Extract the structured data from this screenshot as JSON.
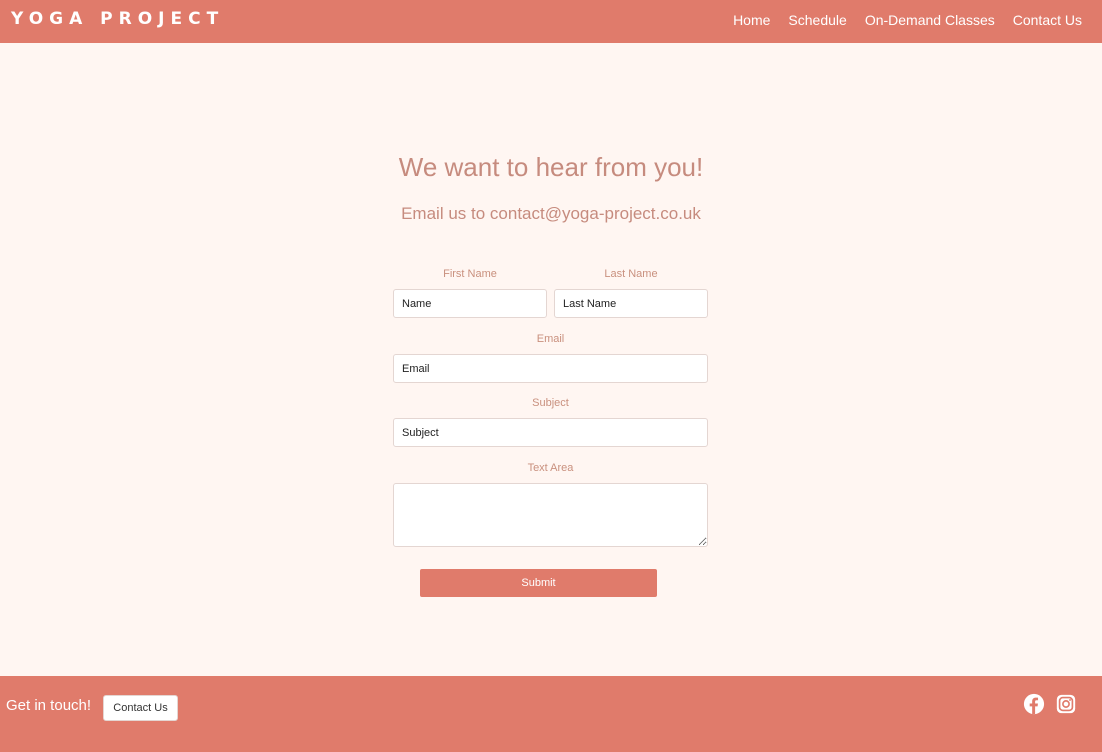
{
  "nav": {
    "brand": "YOGA PROJECT",
    "links": [
      "Home",
      "Schedule",
      "On-Demand Classes",
      "Contact Us"
    ]
  },
  "main": {
    "heading": "We want to hear from you!",
    "email_line": "Email us to contact@yoga-project.co.uk"
  },
  "form": {
    "first_name_label": "First Name",
    "first_name_placeholder": "Name",
    "last_name_label": "Last Name",
    "last_name_placeholder": "Last Name",
    "email_label": "Email",
    "email_placeholder": "Email",
    "subject_label": "Subject",
    "subject_placeholder": "Subject",
    "textarea_label": "Text Area",
    "submit_label": "Submit"
  },
  "footer": {
    "text": "Get in touch!",
    "button_label": "Contact Us",
    "icons": [
      "facebook-icon",
      "instagram-icon"
    ]
  },
  "colors": {
    "brand": "#e07b6b",
    "background": "#fff6f2",
    "text_accent": "#c68b7e"
  }
}
